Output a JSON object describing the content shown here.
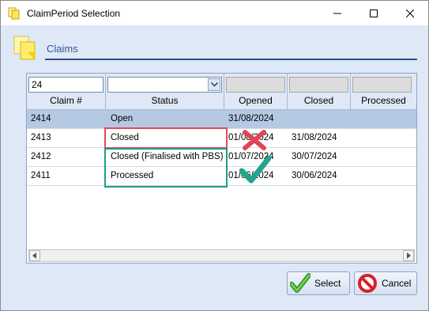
{
  "window": {
    "title": "ClaimPeriod Selection"
  },
  "header": {
    "title": "Claims"
  },
  "grid": {
    "columns": [
      {
        "label": "Claim #",
        "filter_value": "24"
      },
      {
        "label": "Status",
        "filter_value": ""
      },
      {
        "label": "Opened"
      },
      {
        "label": "Closed"
      },
      {
        "label": "Processed"
      }
    ],
    "rows": [
      {
        "claim": "2414",
        "status": "Open",
        "opened": "31/08/2024",
        "closed": "",
        "processed": "",
        "selected": true
      },
      {
        "claim": "2413",
        "status": "Closed",
        "opened": "01/08/2024",
        "closed": "31/08/2024",
        "processed": ""
      },
      {
        "claim": "2412",
        "status": "Closed (Finalised with PBS)",
        "opened": "01/07/2024",
        "closed": "30/07/2024",
        "processed": ""
      },
      {
        "claim": "2411",
        "status": "Processed",
        "opened": "01/06/2024",
        "closed": "30/06/2024",
        "processed": ""
      }
    ]
  },
  "buttons": {
    "select": "Select",
    "cancel": "Cancel"
  },
  "annotations": {
    "red_box_color": "#e04b5c",
    "green_box_color": "#1f9e86"
  }
}
